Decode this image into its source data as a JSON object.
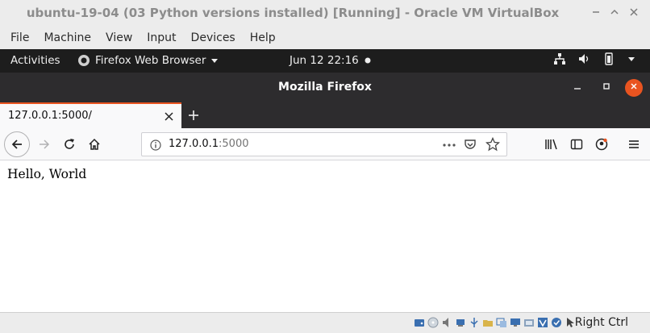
{
  "vbox": {
    "title": "ubuntu-19-04 (03 Python versions installed) [Running] - Oracle VM VirtualBox",
    "menu": [
      "File",
      "Machine",
      "View",
      "Input",
      "Devices",
      "Help"
    ],
    "host_key": "Right Ctrl"
  },
  "gnome": {
    "activities": "Activities",
    "app_name": "Firefox Web Browser",
    "clock": "Jun 12  22:16"
  },
  "firefox": {
    "window_title": "Mozilla Firefox",
    "tab_label": "127.0.0.1:5000/",
    "url_host": "127.0.0.1",
    "url_port": ":5000",
    "page_text": "Hello, World"
  }
}
